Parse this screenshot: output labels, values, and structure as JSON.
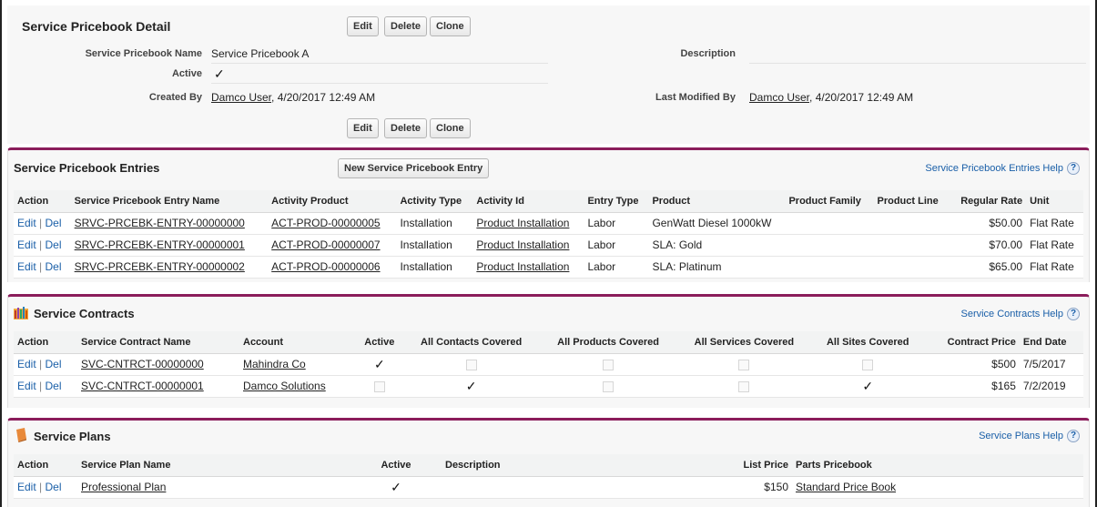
{
  "detail": {
    "title": "Service Pricebook Detail",
    "buttons": {
      "edit": "Edit",
      "delete": "Delete",
      "clone": "Clone"
    },
    "fields": {
      "name_label": "Service Pricebook Name",
      "name_value": "Service Pricebook A",
      "description_label": "Description",
      "active_label": "Active",
      "active_value": "✓",
      "created_label": "Created By",
      "created_user": "Damco User",
      "created_date": ", 4/20/2017 12:49 AM",
      "modified_label": "Last Modified By",
      "modified_user": "Damco User",
      "modified_date": ", 4/20/2017 12:49 AM"
    }
  },
  "entries": {
    "title": "Service Pricebook Entries",
    "new_button": "New Service Pricebook Entry",
    "help": "Service Pricebook Entries Help",
    "columns": [
      "Action",
      "Service Pricebook Entry Name",
      "Activity Product",
      "Activity Type",
      "Activity Id",
      "Entry Type",
      "Product",
      "Product Family",
      "Product Line",
      "Regular Rate",
      "Unit"
    ],
    "rows": [
      {
        "edit": "Edit",
        "del": "Del",
        "name": "SRVC-PRCEBK-ENTRY-00000000",
        "activity_product": "ACT-PROD-00000005",
        "activity_type": "Installation",
        "activity_id": "Product Installation",
        "entry_type": "Labor",
        "product": "GenWatt Diesel 1000kW",
        "family": "",
        "line": "",
        "rate": "$50.00",
        "unit": "Flat Rate"
      },
      {
        "edit": "Edit",
        "del": "Del",
        "name": "SRVC-PRCEBK-ENTRY-00000001",
        "activity_product": "ACT-PROD-00000007",
        "activity_type": "Installation",
        "activity_id": "Product Installation",
        "entry_type": "Labor",
        "product": "SLA: Gold",
        "family": "",
        "line": "",
        "rate": "$70.00",
        "unit": "Flat Rate"
      },
      {
        "edit": "Edit",
        "del": "Del",
        "name": "SRVC-PRCEBK-ENTRY-00000002",
        "activity_product": "ACT-PROD-00000006",
        "activity_type": "Installation",
        "activity_id": "Product Installation",
        "entry_type": "Labor",
        "product": "SLA: Platinum",
        "family": "",
        "line": "",
        "rate": "$65.00",
        "unit": "Flat Rate"
      }
    ]
  },
  "contracts": {
    "title": "Service Contracts",
    "help": "Service Contracts Help",
    "columns": [
      "Action",
      "Service Contract Name",
      "Account",
      "Active",
      "All Contacts Covered",
      "All Products Covered",
      "All Services Covered",
      "All Sites Covered",
      "Contract Price",
      "End Date"
    ],
    "rows": [
      {
        "edit": "Edit",
        "del": "Del",
        "name": "SVC-CNTRCT-00000000",
        "account": "Mahindra Co",
        "active": true,
        "contacts": false,
        "products": false,
        "services": false,
        "sites": false,
        "price": "$500",
        "end": "7/5/2017"
      },
      {
        "edit": "Edit",
        "del": "Del",
        "name": "SVC-CNTRCT-00000001",
        "account": "Damco Solutions",
        "active": false,
        "contacts": true,
        "products": false,
        "services": false,
        "sites": true,
        "price": "$165",
        "end": "7/2/2019"
      }
    ]
  },
  "plans": {
    "title": "Service Plans",
    "help": "Service Plans Help",
    "columns": [
      "Action",
      "Service Plan Name",
      "Active",
      "Description",
      "List Price",
      "Parts Pricebook"
    ],
    "rows": [
      {
        "edit": "Edit",
        "del": "Del",
        "name": "Professional Plan",
        "active": "✓",
        "description": "",
        "price": "$150",
        "pricebook": "Standard Price Book"
      }
    ]
  },
  "glyphs": {
    "check": "✓",
    "help": "?",
    "sep": " | "
  },
  "colors": {
    "accent": "#8b1d5b",
    "link_blue": "#1a5fa8"
  },
  "icons": {
    "contracts": "ruler-chart-icon",
    "plans": "book-icon"
  }
}
